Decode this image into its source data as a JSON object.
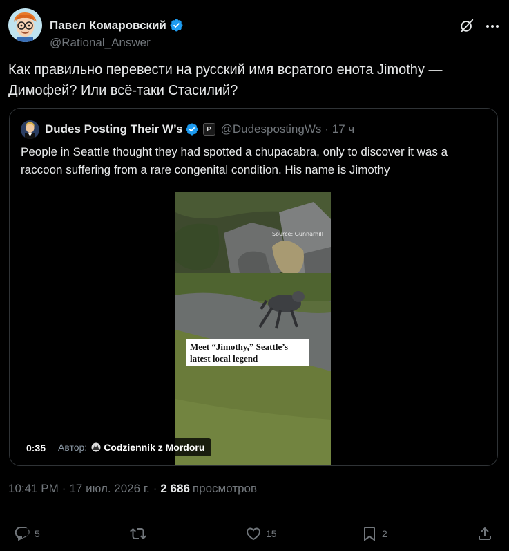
{
  "author": {
    "name": "Павел Комаровский",
    "handle": "@Rational_Answer",
    "verified": true
  },
  "tweet": {
    "text": "Как правильно перевести на русский имя всратого енота Jimothy — Димофей? Или всё-таки Стасилий?"
  },
  "quoted_tweet": {
    "name": "Dudes Posting Their W’s",
    "handle": "@DudespostingWs",
    "time": "· 17 ч",
    "badge": "P",
    "text": "People in Seattle thought they had spotted a chupacabra, only to discover it was a raccoon suffering from a rare congenital condition. His name is Jimothy",
    "media": {
      "caption": "Meet “Jimothy,” Seattle’s latest local legend",
      "source_text": "Source: Gunnarhill",
      "duration": "0:35",
      "author_label": "Автор:",
      "author_name": "Codziennik z Mordoru"
    }
  },
  "meta": {
    "time": "10:41 PM",
    "sep1": "·",
    "date": "17 июл. 2026 г.",
    "sep2": "·",
    "views_count": "2 686",
    "views_label": "просмотров"
  },
  "actions": {
    "replies": "5",
    "reposts": "",
    "likes": "15",
    "bookmarks": "2"
  },
  "colors": {
    "background": "#000000",
    "text": "#e7e9ea",
    "secondary": "#71767b",
    "border": "#2f3336",
    "verified": "#1d9bf0"
  }
}
